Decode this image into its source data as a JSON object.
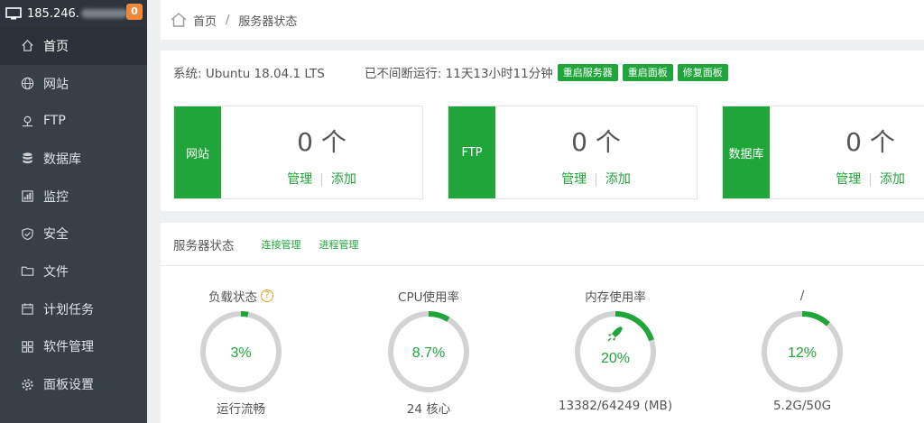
{
  "sidebar": {
    "ip": "185.246.",
    "badge": "0",
    "items": [
      {
        "label": "首页",
        "icon": "home-icon"
      },
      {
        "label": "网站",
        "icon": "globe-icon"
      },
      {
        "label": "FTP",
        "icon": "ftp-icon"
      },
      {
        "label": "数据库",
        "icon": "database-icon"
      },
      {
        "label": "监控",
        "icon": "monitor-icon"
      },
      {
        "label": "安全",
        "icon": "shield-icon"
      },
      {
        "label": "文件",
        "icon": "folder-icon"
      },
      {
        "label": "计划任务",
        "icon": "calendar-icon"
      },
      {
        "label": "软件管理",
        "icon": "grid-icon"
      },
      {
        "label": "面板设置",
        "icon": "gear-icon"
      }
    ]
  },
  "breadcrumb": {
    "home": "首页",
    "separator": "/",
    "current": "服务器状态"
  },
  "system": {
    "os": "系统: Ubuntu 18.04.1 LTS",
    "uptime": "已不间断运行: 11天13小时11分钟",
    "buttons": [
      "重启服务器",
      "重启面板",
      "修复面板"
    ]
  },
  "stats": [
    {
      "label": "网站",
      "count": "0 个",
      "manage": "管理",
      "add": "添加"
    },
    {
      "label": "FTP",
      "count": "0 个",
      "manage": "管理",
      "add": "添加"
    },
    {
      "label": "数据库",
      "count": "0 个",
      "manage": "管理",
      "add": "添加"
    }
  ],
  "server_status": {
    "title": "服务器状态",
    "links": [
      "连接管理",
      "进程管理"
    ],
    "gauges": [
      {
        "title": "负载状态",
        "value": "3%",
        "percent": 3,
        "footer": "运行流畅",
        "help": "?"
      },
      {
        "title": "CPU使用率",
        "value": "8.7%",
        "percent": 8.7,
        "footer": "24 核心"
      },
      {
        "title": "内存使用率",
        "value": "20%",
        "percent": 20,
        "footer": "13382/64249 (MB)",
        "icon": "rocket-icon"
      },
      {
        "title": "/",
        "value": "12%",
        "percent": 12,
        "footer": "5.2G/50G"
      }
    ]
  },
  "colors": {
    "accent": "#20a53a",
    "sidebar": "#373f47",
    "ring_track": "#d3d3d3",
    "badge": "#f0883a"
  }
}
